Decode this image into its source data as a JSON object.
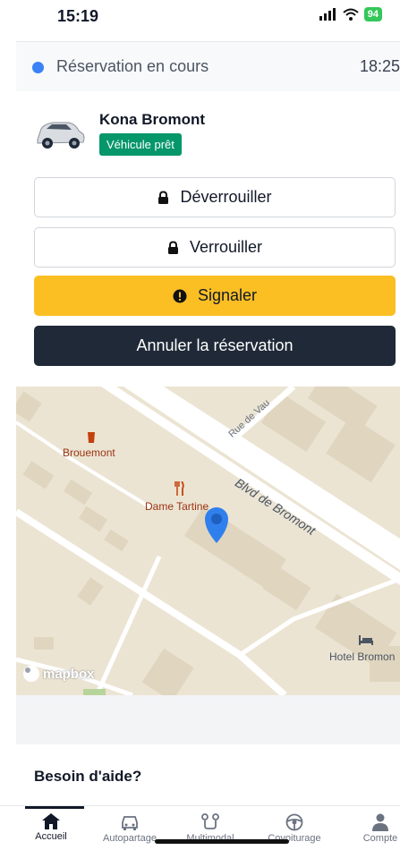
{
  "status_bar": {
    "time": "15:19",
    "battery": "94"
  },
  "reservation": {
    "label": "Réservation en cours",
    "time": "18:25"
  },
  "vehicle": {
    "name": "Kona Bromont",
    "status": "Véhicule prêt"
  },
  "buttons": {
    "unlock": "Déverrouiller",
    "lock": "Verrouiller",
    "report": "Signaler",
    "cancel": "Annuler la réservation"
  },
  "map": {
    "poi_brouemont": "Brouemont",
    "poi_dame": "Dame Tartine",
    "street_vau": "Rue de Vau",
    "street_bromont": "Blvd de Bromont",
    "poi_hotel": "Hotel Bromon",
    "attribution": "mapbox"
  },
  "help": {
    "title": "Besoin d'aide?"
  },
  "nav": {
    "items": [
      {
        "label": "Accueil",
        "icon": "home-icon"
      },
      {
        "label": "Autopartage",
        "icon": "car-icon"
      },
      {
        "label": "Multimodal",
        "icon": "route-icon"
      },
      {
        "label": "Covoiturage",
        "icon": "steering-wheel-icon"
      },
      {
        "label": "Compte",
        "icon": "person-icon"
      }
    ]
  },
  "colors": {
    "accent_blue": "#3b82f6",
    "ready_green": "#059669",
    "report_yellow": "#fbbf24",
    "dark_button": "#1f2937"
  }
}
